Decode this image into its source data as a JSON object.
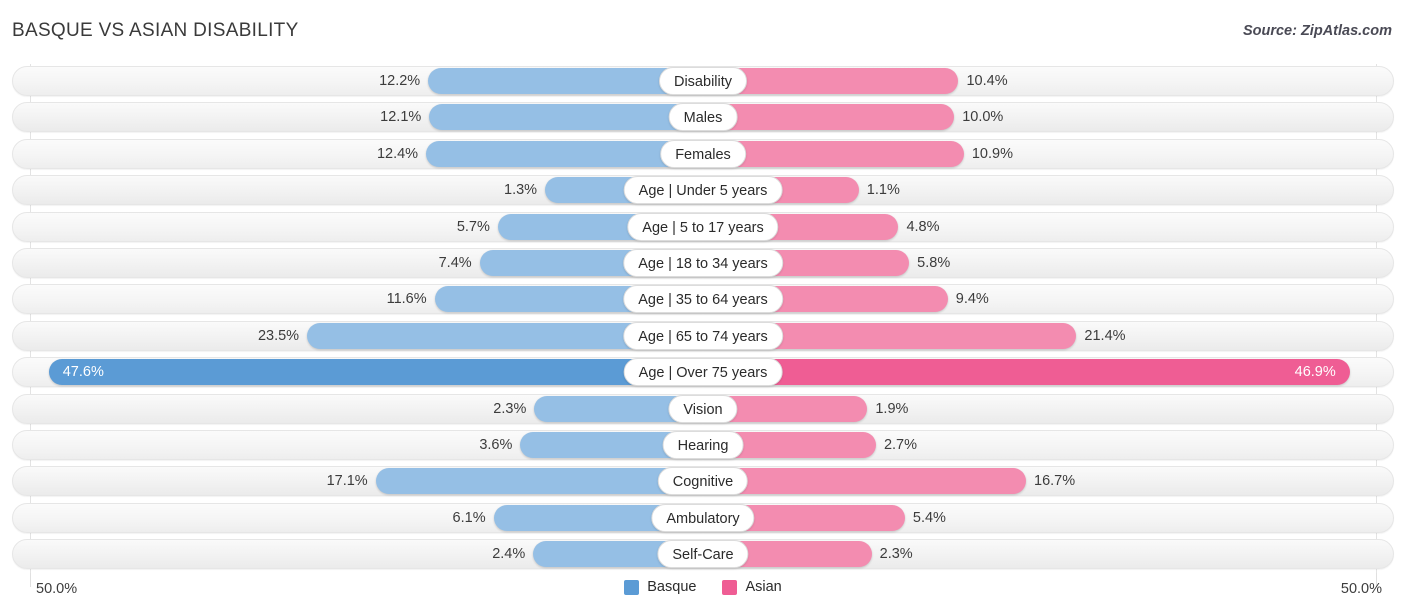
{
  "header": {
    "title": "BASQUE VS ASIAN DISABILITY",
    "source": "Source: ZipAtlas.com"
  },
  "footer": {
    "axis_left": "50.0%",
    "axis_right": "50.0%",
    "legend": [
      {
        "label": "Basque",
        "color": "#5b9bd5"
      },
      {
        "label": "Asian",
        "color": "#ef5d94"
      }
    ]
  },
  "colors": {
    "basque_bar": "#95bfe5",
    "asian_bar": "#f38cb0",
    "basque_bar_highlight": "#5b9bd5",
    "asian_bar_highlight": "#ef5d94",
    "track": "#f5f5f5",
    "gridline": "#e3e3e3"
  },
  "chart_data": {
    "type": "bar",
    "title": "BASQUE VS ASIAN DISABILITY",
    "subtitle": "Source: ZipAtlas.com",
    "orientation": "horizontal-diverging",
    "xlabel": "",
    "ylabel": "",
    "xlim": [
      -50.0,
      50.0
    ],
    "axis_tick_labels": [
      "50.0%",
      "50.0%"
    ],
    "grid": false,
    "legend_position": "bottom-center",
    "categories": [
      "Disability",
      "Males",
      "Females",
      "Age | Under 5 years",
      "Age | 5 to 17 years",
      "Age | 18 to 34 years",
      "Age | 35 to 64 years",
      "Age | 65 to 74 years",
      "Age | Over 75 years",
      "Vision",
      "Hearing",
      "Cognitive",
      "Ambulatory",
      "Self-Care"
    ],
    "series": [
      {
        "name": "Basque",
        "side": "left",
        "values": [
          12.2,
          12.1,
          12.4,
          1.3,
          5.7,
          7.4,
          11.6,
          23.5,
          47.6,
          2.3,
          3.6,
          17.1,
          6.1,
          2.4
        ],
        "labels": [
          "12.2%",
          "12.1%",
          "12.4%",
          "1.3%",
          "5.7%",
          "7.4%",
          "11.6%",
          "23.5%",
          "47.6%",
          "2.3%",
          "3.6%",
          "17.1%",
          "6.1%",
          "2.4%"
        ]
      },
      {
        "name": "Asian",
        "side": "right",
        "values": [
          10.4,
          10.0,
          10.9,
          1.1,
          4.8,
          5.8,
          9.4,
          21.4,
          46.9,
          1.9,
          2.7,
          16.7,
          5.4,
          2.3
        ],
        "labels": [
          "10.4%",
          "10.0%",
          "10.9%",
          "1.1%",
          "4.8%",
          "5.8%",
          "9.4%",
          "21.4%",
          "46.9%",
          "1.9%",
          "2.7%",
          "16.7%",
          "5.4%",
          "2.3%"
        ]
      }
    ],
    "highlight_row_index": 8
  }
}
